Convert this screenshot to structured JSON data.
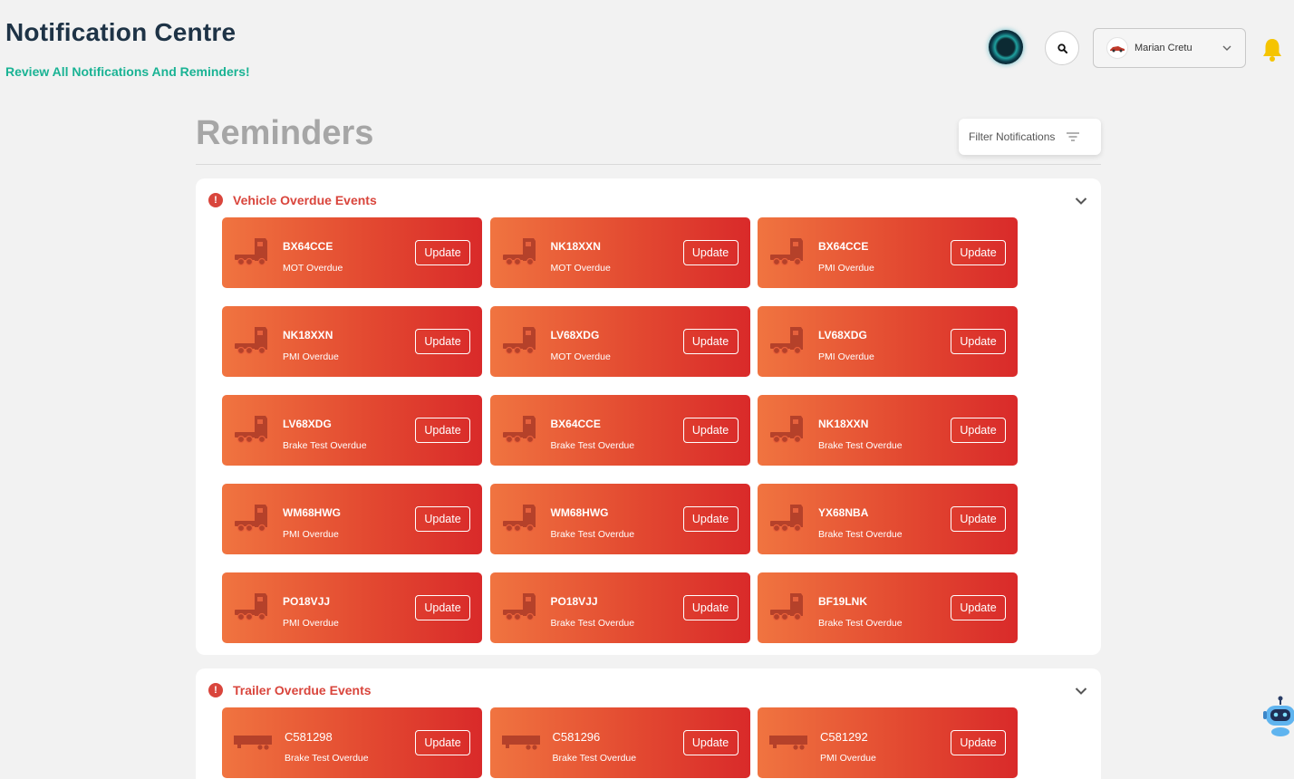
{
  "header": {
    "title": "Notification Centre",
    "subtitle": "Review All Notifications And Reminders!",
    "user_name": "Marian Cretu"
  },
  "reminders": {
    "heading": "Reminders",
    "filter_label": "Filter Notifications"
  },
  "vehicle_panel": {
    "title": "Vehicle Overdue Events",
    "cards": [
      {
        "reg": "BX64CCE",
        "event": "MOT Overdue",
        "action": "Update"
      },
      {
        "reg": "NK18XXN",
        "event": "MOT Overdue",
        "action": "Update"
      },
      {
        "reg": "BX64CCE",
        "event": "PMI Overdue",
        "action": "Update"
      },
      {
        "reg": "NK18XXN",
        "event": "PMI Overdue",
        "action": "Update"
      },
      {
        "reg": "LV68XDG",
        "event": "MOT Overdue",
        "action": "Update"
      },
      {
        "reg": "LV68XDG",
        "event": "PMI Overdue",
        "action": "Update"
      },
      {
        "reg": "LV68XDG",
        "event": "Brake Test Overdue",
        "action": "Update"
      },
      {
        "reg": "BX64CCE",
        "event": "Brake Test Overdue",
        "action": "Update"
      },
      {
        "reg": "NK18XXN",
        "event": "Brake Test Overdue",
        "action": "Update"
      },
      {
        "reg": "WM68HWG",
        "event": "PMI Overdue",
        "action": "Update"
      },
      {
        "reg": "WM68HWG",
        "event": "Brake Test Overdue",
        "action": "Update"
      },
      {
        "reg": "YX68NBA",
        "event": "Brake Test Overdue",
        "action": "Update"
      },
      {
        "reg": "PO18VJJ",
        "event": "PMI Overdue",
        "action": "Update"
      },
      {
        "reg": "PO18VJJ",
        "event": "Brake Test Overdue",
        "action": "Update"
      },
      {
        "reg": "BF19LNK",
        "event": "Brake Test Overdue",
        "action": "Update"
      }
    ]
  },
  "trailer_panel": {
    "title": "Trailer Overdue Events",
    "cards": [
      {
        "reg": "C581298",
        "event": "Brake Test Overdue",
        "action": "Update"
      },
      {
        "reg": "C581296",
        "event": "Brake Test Overdue",
        "action": "Update"
      },
      {
        "reg": "C581292",
        "event": "PMI Overdue",
        "action": "Update"
      }
    ]
  },
  "colors": {
    "title": "#1e3346",
    "accent_green": "#1ab394",
    "alert_red": "#d9453c",
    "card_gradient_start": "#f07440",
    "card_gradient_end": "#d92a2a",
    "bell": "#f5c400"
  },
  "icons": {
    "orb": "ai-orb-icon",
    "search": "search-icon",
    "bell": "bell-icon",
    "filter": "filter-icon",
    "alert": "alert-icon",
    "chevron": "chevron-down-icon",
    "vehicle": "truck-icon",
    "trailer": "trailer-icon",
    "assistant": "robot-icon"
  }
}
